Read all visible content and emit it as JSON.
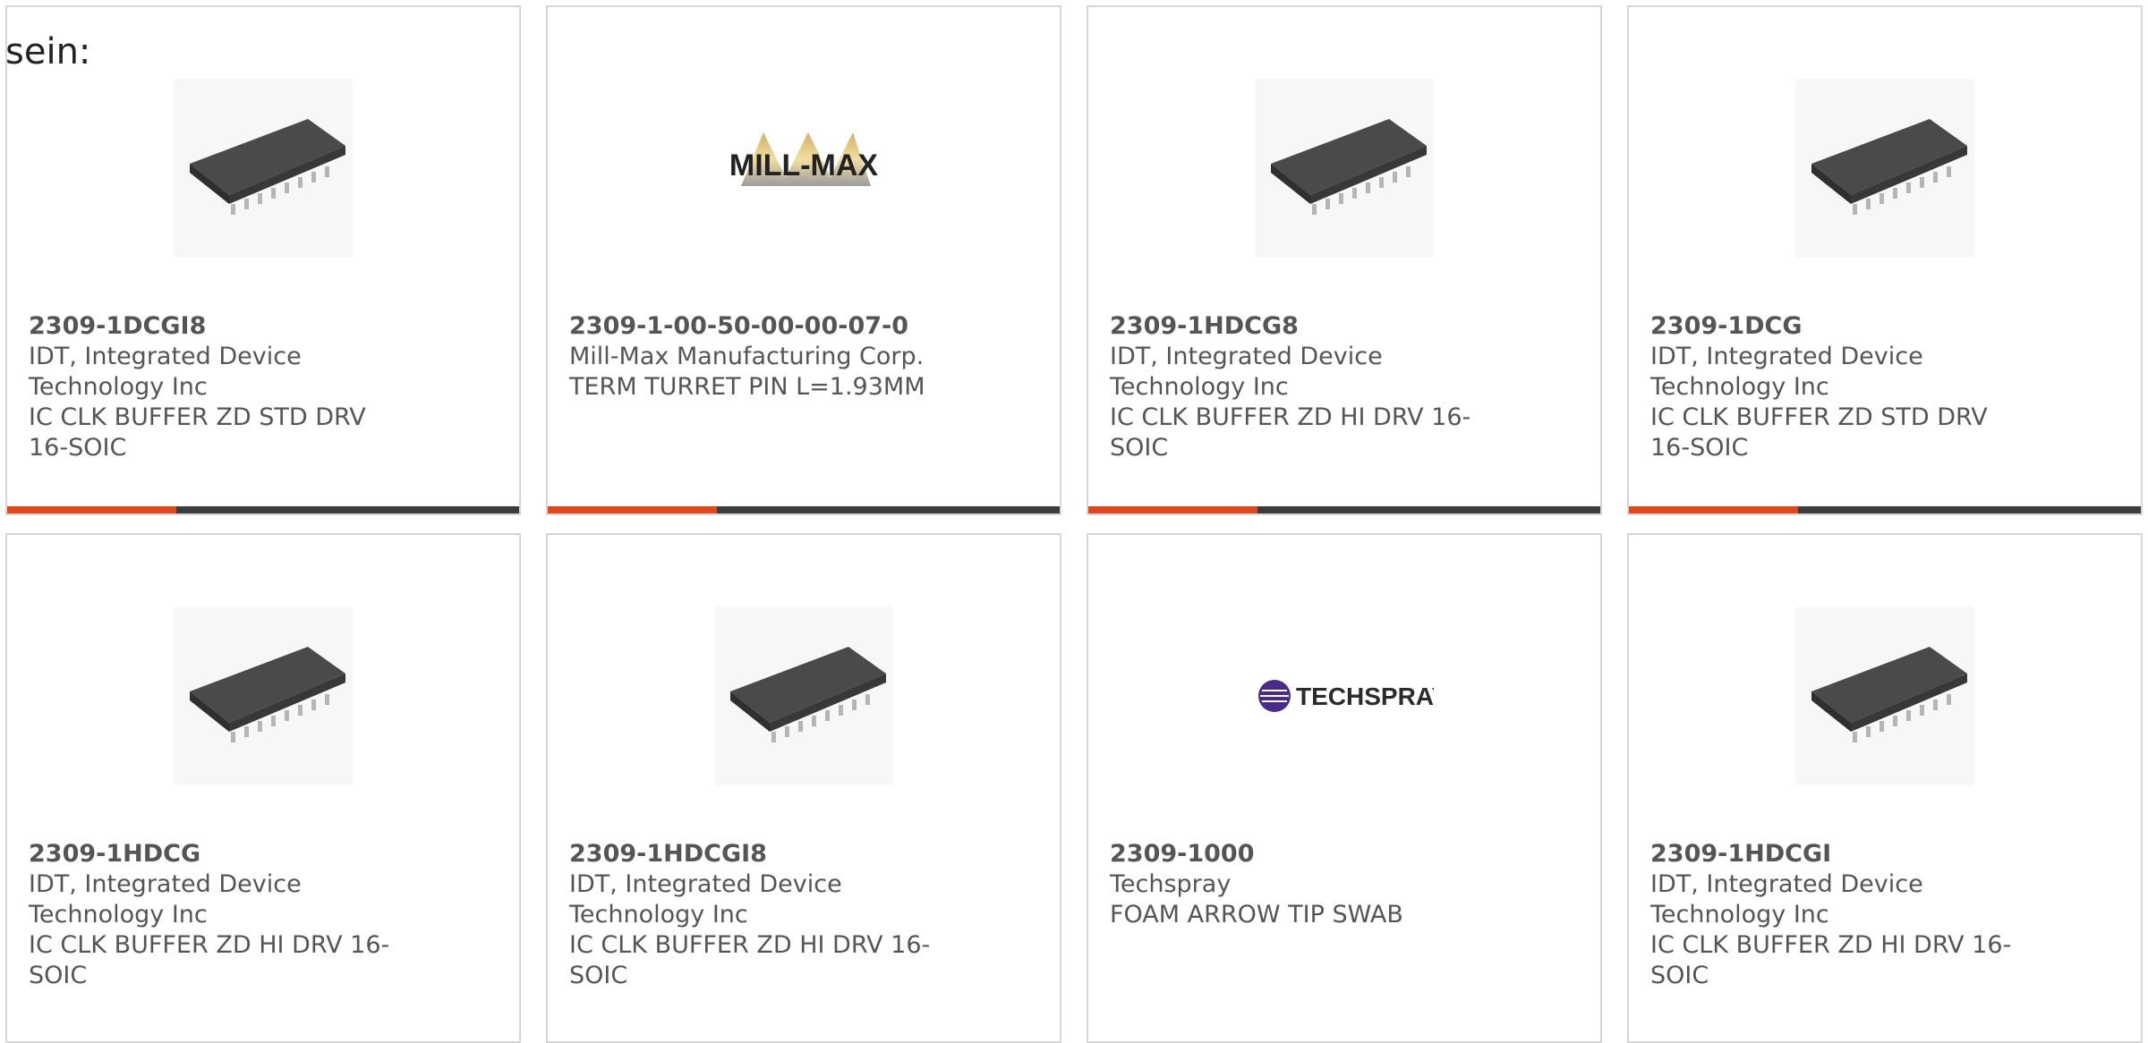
{
  "intro_text": "sein:",
  "colors": {
    "accent": "#e1471b",
    "bar_dark": "#3c3c3c",
    "card_border": "#d6d6d6",
    "text": "#555555"
  },
  "products": [
    {
      "part_number": "2309-1DCGI8",
      "manufacturer": "IDT, Integrated Device Technology Inc",
      "description": "IC CLK BUFFER ZD STD DRV 16-SOIC",
      "image": "soic-16-chip-icon",
      "bar_progress": 0.33
    },
    {
      "part_number": "2309-1-00-50-00-00-07-0",
      "manufacturer": "Mill-Max Manufacturing Corp.",
      "description": "TERM TURRET PIN L=1.93MM",
      "image": "mill-max-logo",
      "logo_text": "MILL-MAX",
      "bar_progress": 0.33
    },
    {
      "part_number": "2309-1HDCG8",
      "manufacturer": "IDT, Integrated Device Technology Inc",
      "description": "IC CLK BUFFER ZD HI DRV 16-SOIC",
      "image": "soic-16-chip-icon",
      "bar_progress": 0.33
    },
    {
      "part_number": "2309-1DCG",
      "manufacturer": "IDT, Integrated Device Technology Inc",
      "description": "IC CLK BUFFER ZD STD DRV 16-SOIC",
      "image": "soic-16-chip-icon",
      "bar_progress": 0.33
    },
    {
      "part_number": "2309-1HDCG",
      "manufacturer": "IDT, Integrated Device Technology Inc",
      "description": "IC CLK BUFFER ZD HI DRV 16-SOIC",
      "image": "soic-16-chip-icon"
    },
    {
      "part_number": "2309-1HDCGI8",
      "manufacturer": "IDT, Integrated Device Technology Inc",
      "description": "IC CLK BUFFER ZD HI DRV 16-SOIC",
      "image": "soic-16-chip-icon"
    },
    {
      "part_number": "2309-1000",
      "manufacturer": "Techspray",
      "description": "FOAM ARROW TIP SWAB",
      "image": "techspray-logo",
      "logo_text": "TECHSPRAY"
    },
    {
      "part_number": "2309-1HDCGI",
      "manufacturer": "IDT, Integrated Device Technology Inc",
      "description": "IC CLK BUFFER ZD HI DRV 16-SOIC",
      "image": "soic-16-chip-icon"
    }
  ]
}
